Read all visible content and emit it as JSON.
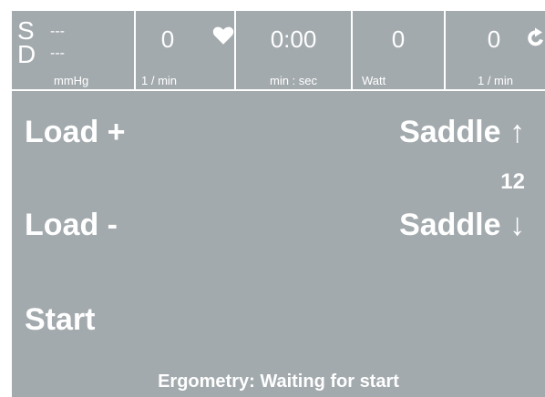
{
  "header": {
    "bp": {
      "systolic_label": "S",
      "diastolic_label": "D",
      "systolic": "---",
      "diastolic": "---",
      "unit": "mmHg"
    },
    "heart_rate": {
      "value": "0",
      "unit": "1 / min",
      "icon": "heart-icon"
    },
    "time": {
      "value": "0:00",
      "unit": "min : sec"
    },
    "power": {
      "value": "0",
      "unit": "Watt"
    },
    "cadence": {
      "value": "0",
      "unit": "1 / min",
      "icon": "rotate-icon"
    }
  },
  "controls": {
    "load_plus": "Load +",
    "load_minus": "Load -",
    "saddle_up": "Saddle ↑",
    "saddle_down": "Saddle ↓",
    "saddle_value": "12",
    "start": "Start"
  },
  "status": "Ergometry: Waiting for start",
  "colors": {
    "background": "#a3aaad",
    "foreground": "#ffffff"
  }
}
